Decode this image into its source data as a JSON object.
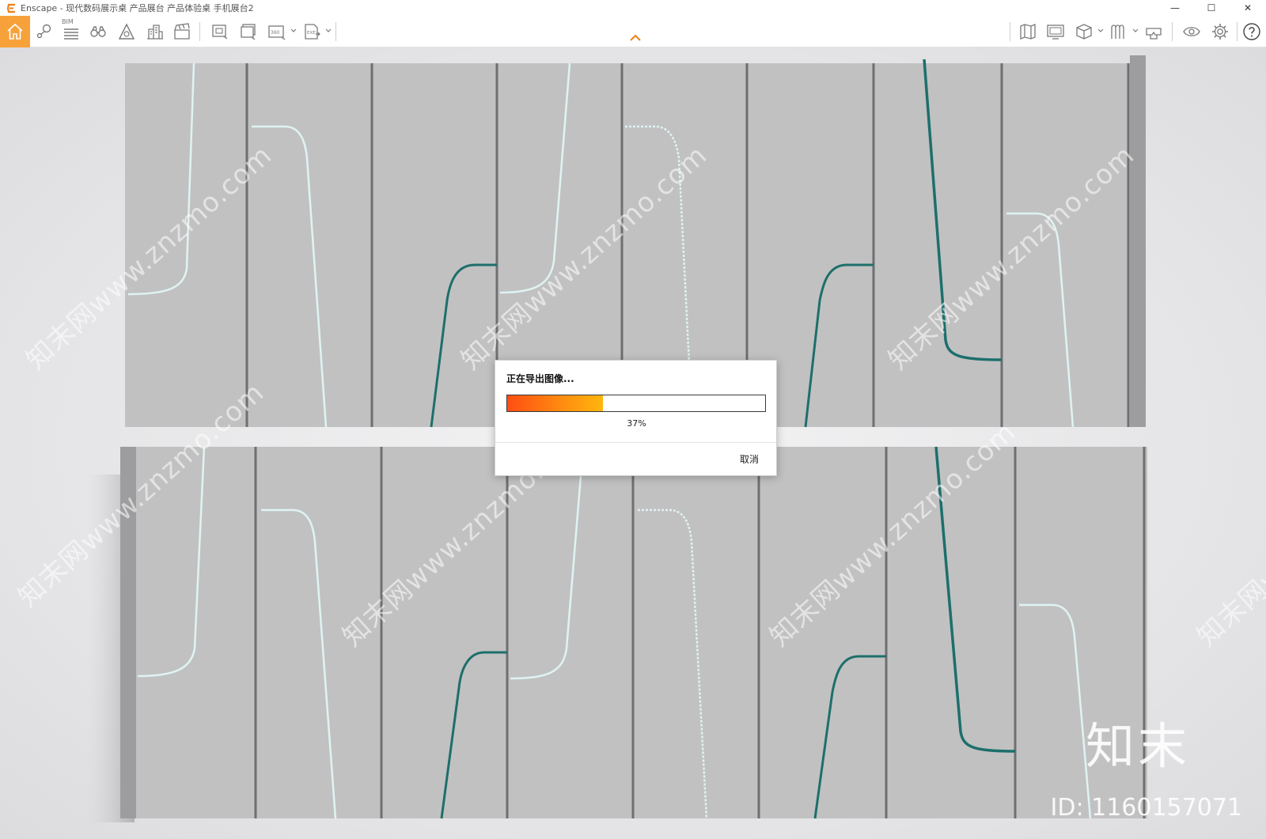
{
  "window": {
    "title": "Enscape - 现代数码展示桌 产品展台 产品体验桌 手机展台2",
    "minimize_symbol": "—",
    "maximize_symbol": "☐",
    "close_symbol": "✕"
  },
  "toolbar": {
    "bim_label": "BIM",
    "left_icons": [
      "home-icon",
      "location-pin-icon",
      "bim-list-icon",
      "binoculars-icon",
      "atmosphere-icon",
      "buildings-icon",
      "clapperboard-icon",
      "screenshot-icon",
      "batch-render-icon",
      "panorama-360-icon",
      "export-exe-icon"
    ],
    "right_icons": [
      "map-icon",
      "monitor-icon",
      "cube-asset-icon",
      "material-editor-icon",
      "vr-headset-icon",
      "eye-visual-settings-icon",
      "gear-icon",
      "help-icon"
    ],
    "accent_color": "#f7a13a"
  },
  "viewport": {
    "watermark": "知末网www.znzmo.com",
    "brand_mark": "知末",
    "brand_id": "ID: 1160157071"
  },
  "dialog": {
    "title": "正在导出图像...",
    "progress": 0.37,
    "progress_text": "37%",
    "cancel_label": "取消"
  }
}
